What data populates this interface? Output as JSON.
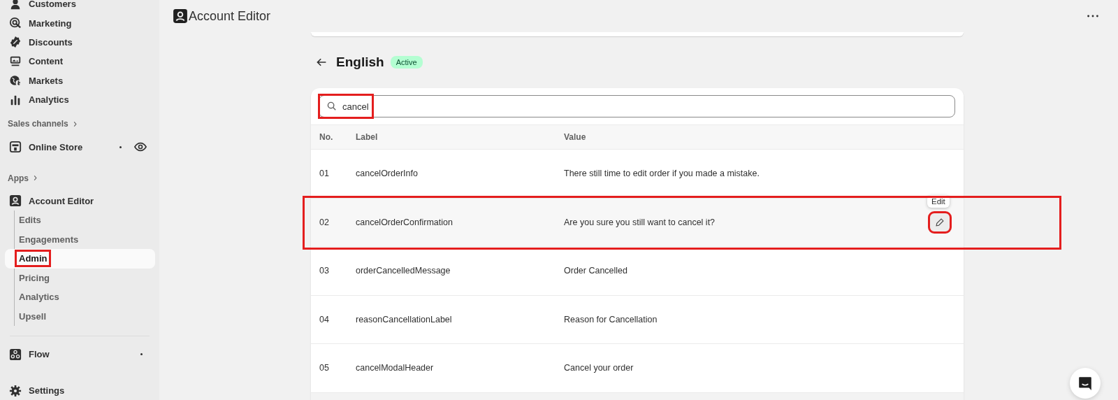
{
  "sidebar": {
    "items": [
      {
        "label": "Customers",
        "kind": "person"
      },
      {
        "label": "Marketing",
        "kind": "target"
      },
      {
        "label": "Discounts",
        "kind": "badge"
      },
      {
        "label": "Content",
        "kind": "monitor"
      },
      {
        "label": "Markets",
        "kind": "globe"
      },
      {
        "label": "Analytics",
        "kind": "bars"
      }
    ],
    "sales_channels": {
      "heading": "Sales channels",
      "items": [
        {
          "label": "Online Store",
          "kind": "store",
          "dot": true,
          "eye": true
        }
      ]
    },
    "apps": {
      "heading": "Apps",
      "items": [
        {
          "label": "Account Editor",
          "kind": "app",
          "children": [
            {
              "label": "Edits",
              "selected": false,
              "annotated": false
            },
            {
              "label": "Engagements",
              "selected": false,
              "annotated": false
            },
            {
              "label": "Admin",
              "selected": true,
              "annotated": true
            },
            {
              "label": "Pricing",
              "selected": false,
              "annotated": false
            },
            {
              "label": "Analytics",
              "selected": false,
              "annotated": false
            },
            {
              "label": "Upsell",
              "selected": false,
              "annotated": false
            }
          ]
        }
      ]
    },
    "other_apps": [
      {
        "label": "Flow",
        "kind": "flow",
        "dot": true
      }
    ],
    "settings": {
      "label": "Settings"
    }
  },
  "header": {
    "title": "Account Editor"
  },
  "page": {
    "title": "English",
    "status": "Active"
  },
  "search": {
    "value": "cancel",
    "annotated": true
  },
  "table": {
    "columns": [
      "No.",
      "Label",
      "Value"
    ],
    "rows": [
      {
        "no": "01",
        "label": "cancelOrderInfo",
        "value": "There still time to edit order if you made a mistake.",
        "hovered": false,
        "annotated": false
      },
      {
        "no": "02",
        "label": "cancelOrderConfirmation",
        "value": "Are you sure you still want to cancel it?",
        "hovered": true,
        "annotated": true,
        "tooltip": "Edit"
      },
      {
        "no": "03",
        "label": "orderCancelledMessage",
        "value": "Order Cancelled",
        "hovered": false,
        "annotated": false
      },
      {
        "no": "04",
        "label": "reasonCancellationLabel",
        "value": "Reason for Cancellation",
        "hovered": false,
        "annotated": false
      },
      {
        "no": "05",
        "label": "cancelModalHeader",
        "value": "Cancel your order",
        "hovered": false,
        "annotated": false
      }
    ]
  }
}
